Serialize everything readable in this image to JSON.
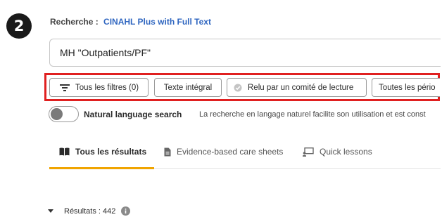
{
  "step_badge": "2",
  "database": {
    "label": "Recherche :",
    "name": "CINAHL Plus with Full Text"
  },
  "search": {
    "query": "MH \"Outpatients/PF\""
  },
  "filters": {
    "all_filters": "Tous les filtres (0)",
    "full_text": "Texte intégral",
    "peer_reviewed": "Relu par un comité de lecture",
    "all_periods": "Toutes les pério"
  },
  "natural_language": {
    "label": "Natural language search",
    "description": "La recherche en langage naturel facilite son utilisation et est const"
  },
  "tabs": [
    {
      "label": "Tous les résultats",
      "icon": "book-icon"
    },
    {
      "label": "Evidence-based care sheets",
      "icon": "document-icon"
    },
    {
      "label": "Quick lessons",
      "icon": "presentation-icon"
    }
  ],
  "results": {
    "label": "Résultats : 442"
  },
  "colors": {
    "highlight": "#e02020",
    "link": "#2f66c0",
    "tab_active_underline": "#f0a400"
  }
}
